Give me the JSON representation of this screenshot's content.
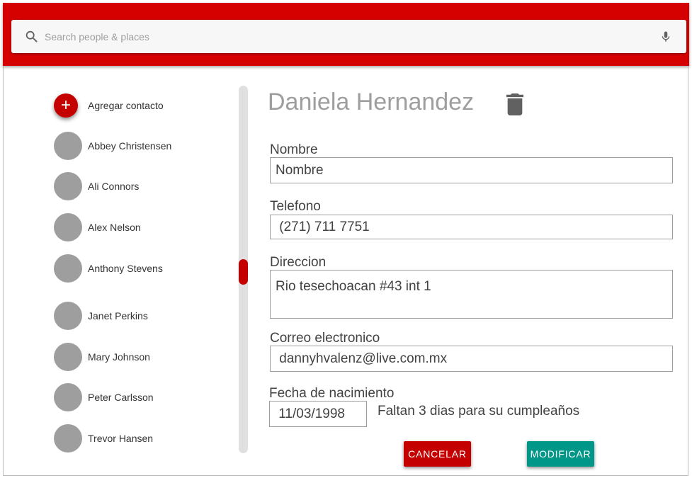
{
  "search": {
    "placeholder": "Search people & places"
  },
  "contacts": {
    "add_label": "Agregar contacto",
    "items": [
      {
        "name": "Abbey Christensen"
      },
      {
        "name": "Ali Connors"
      },
      {
        "name": "Alex Nelson"
      },
      {
        "name": "Anthony Stevens"
      },
      {
        "name": "Janet Perkins"
      },
      {
        "name": "Mary Johnson"
      },
      {
        "name": "Peter Carlsson"
      },
      {
        "name": "Trevor Hansen"
      }
    ]
  },
  "detail": {
    "title": "Daniela Hernandez",
    "fields": {
      "nombre": {
        "label": "Nombre",
        "value": "Nombre"
      },
      "telefono": {
        "label": "Telefono",
        "value": " (271) 711 7751"
      },
      "direccion": {
        "label": "Direccion",
        "value": "Rio tesechoacan #43 int 1"
      },
      "correo": {
        "label": "Correo electronico",
        "value": " dannyhvalenz@live.com.mx"
      },
      "fecha": {
        "label": "Fecha de nacimiento",
        "value": " 11/03/1998"
      }
    },
    "birthday_hint": "Faltan 3 dias para su cumpleaños",
    "cancel_label": "CANCELAR",
    "modify_label": "MODIFICAR"
  },
  "colors": {
    "brand_red": "#d50000",
    "accent_red": "#c40000",
    "teal": "#009688",
    "avatar_gray": "#9e9e9e"
  },
  "icons": [
    "search-icon",
    "mic-icon",
    "plus-icon",
    "trash-icon"
  ]
}
